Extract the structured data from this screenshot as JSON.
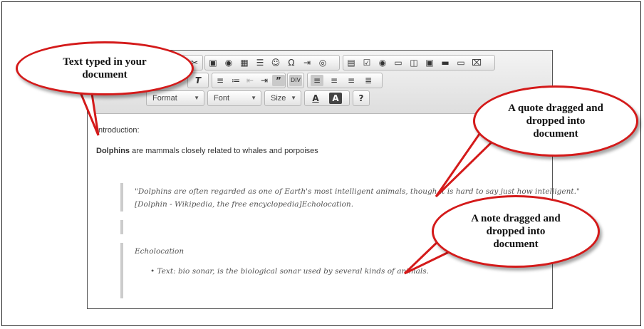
{
  "toolbar": {
    "row3": {
      "format": "Format",
      "font": "Font",
      "size": "Size",
      "help": "?"
    }
  },
  "document": {
    "intro": "Introduction:",
    "dolphins_bold": "Dolphins",
    "dolphins_rest": " are mammals closely related to whales and porpoises",
    "quote_line1": "\"Dolphins are often regarded as one of Earth's most intelligent animals, though it is hard to say just how intelligent.\"",
    "quote_line2": "[Dolphin - Wikipedia, the free encyclopedia]Echolocation.",
    "note_title": "Echolocation",
    "note_item": "Text: bio sonar, is the biological sonar used by several kinds of animals."
  },
  "callouts": {
    "typed": "Text typed in your document",
    "quote": "A quote dragged and dropped into document",
    "note": "A note dragged and dropped into document"
  },
  "colors": {
    "balloon_border": "#d41a1a"
  }
}
